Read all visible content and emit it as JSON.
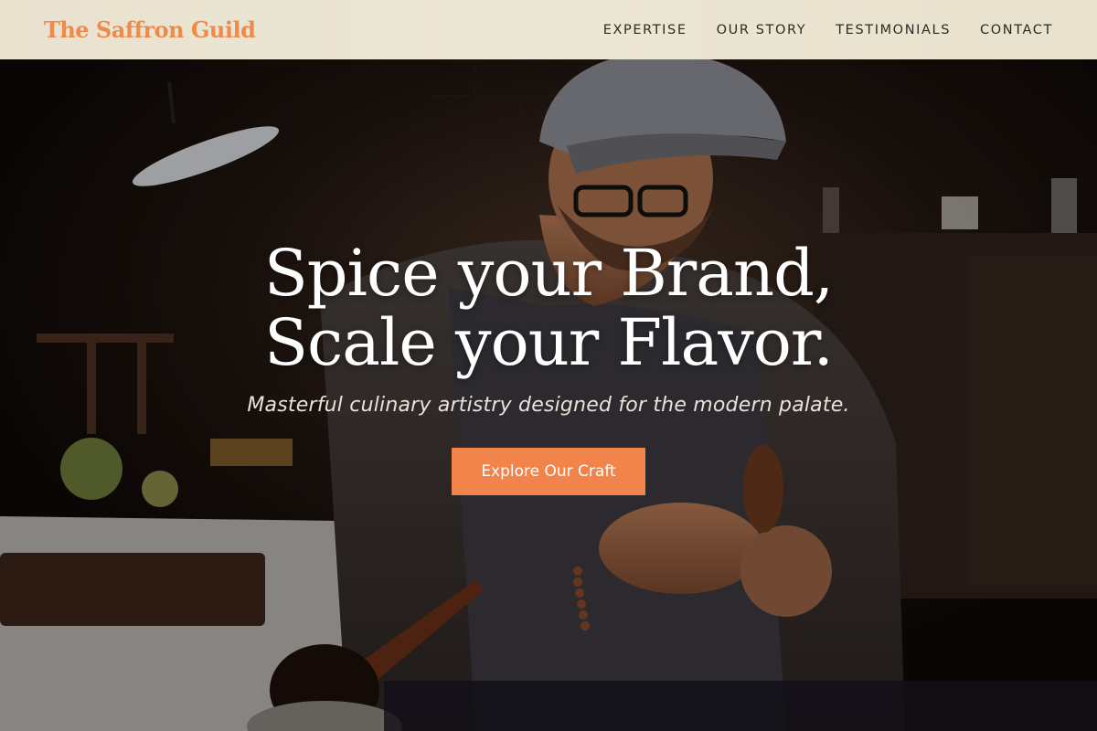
{
  "header": {
    "logo": "The Saffron Guild",
    "nav": [
      {
        "label": "EXPERTISE"
      },
      {
        "label": "OUR STORY"
      },
      {
        "label": "TESTIMONIALS"
      },
      {
        "label": "CONTACT"
      }
    ]
  },
  "hero": {
    "title": "Spice your Brand, Scale your Flavor.",
    "subtitle": "Masterful culinary artistry designed for the modern palate.",
    "cta_label": "Explore Our Craft"
  },
  "colors": {
    "accent": "#f0844a",
    "header_bg": "#ece6d5",
    "logo": "#f08a4b",
    "nav_text": "#2f2a24"
  }
}
